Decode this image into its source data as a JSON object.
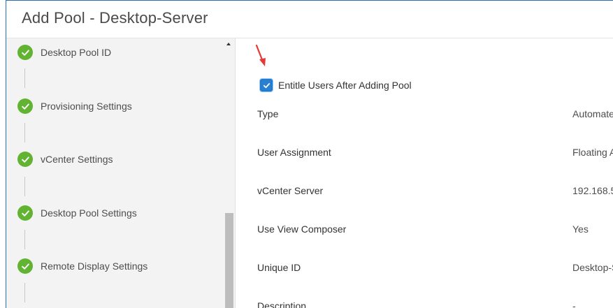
{
  "header": {
    "title": "Add Pool - Desktop-Server"
  },
  "sidebar": {
    "steps": [
      {
        "label": "Desktop Pool ID",
        "status": "complete"
      },
      {
        "label": "Provisioning Settings",
        "status": "complete"
      },
      {
        "label": "vCenter Settings",
        "status": "complete"
      },
      {
        "label": "Desktop Pool Settings",
        "status": "complete"
      },
      {
        "label": "Remote Display Settings",
        "status": "complete"
      }
    ]
  },
  "content": {
    "entitle": {
      "label": "Entitle Users After Adding Pool",
      "checked": true
    },
    "summary": [
      {
        "label": "Type",
        "value": "Automate"
      },
      {
        "label": "User Assignment",
        "value": "Floating A"
      },
      {
        "label": "vCenter Server",
        "value": "192.168.5"
      },
      {
        "label": "Use View Composer",
        "value": "Yes"
      },
      {
        "label": "Unique ID",
        "value": "Desktop-S"
      },
      {
        "label": "Description",
        "value": "-"
      }
    ]
  },
  "colors": {
    "accent": "#2a7fcf",
    "success": "#61b331",
    "annotation_arrow": "#e53935"
  }
}
